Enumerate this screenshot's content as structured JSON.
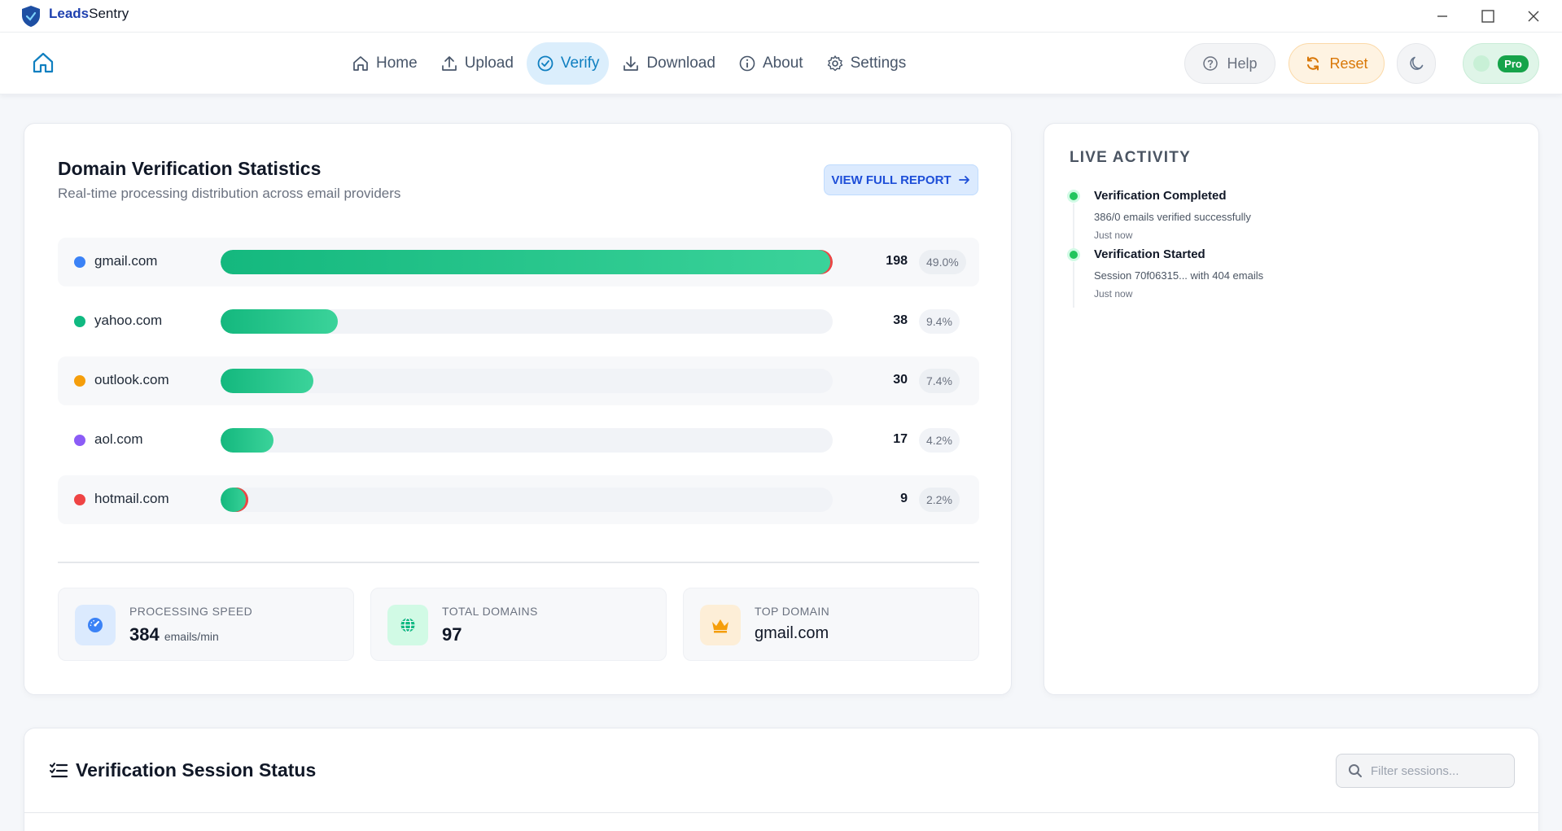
{
  "app": {
    "title_a": "Leads",
    "title_b": "Sentry"
  },
  "nav": [
    {
      "label": "Home",
      "icon": "home-icon"
    },
    {
      "label": "Upload",
      "icon": "upload-icon"
    },
    {
      "label": "Verify",
      "icon": "check-circle-icon",
      "active": true
    },
    {
      "label": "Download",
      "icon": "download-icon"
    },
    {
      "label": "About",
      "icon": "info-icon"
    },
    {
      "label": "Settings",
      "icon": "gear-icon"
    }
  ],
  "header_buttons": {
    "help": "Help",
    "reset": "Reset",
    "pro": "Pro"
  },
  "stats": {
    "title": "Domain Verification Statistics",
    "subtitle": "Real-time processing distribution across email providers",
    "report_button": "VIEW FULL REPORT",
    "domains": [
      {
        "name": "gmail.com",
        "count": "198",
        "percent": "49.0%",
        "fraction": 1.0,
        "color": "#3b82f6"
      },
      {
        "name": "yahoo.com",
        "count": "38",
        "percent": "9.4%",
        "fraction": 0.192,
        "color": "#10b981"
      },
      {
        "name": "outlook.com",
        "count": "30",
        "percent": "7.4%",
        "fraction": 0.152,
        "color": "#f59e0b"
      },
      {
        "name": "aol.com",
        "count": "17",
        "percent": "4.2%",
        "fraction": 0.086,
        "color": "#8b5cf6"
      },
      {
        "name": "hotmail.com",
        "count": "9",
        "percent": "2.2%",
        "fraction": 0.045,
        "color": "#ef4444"
      }
    ],
    "metrics": {
      "speed_label": "PROCESSING SPEED",
      "speed_value": "384",
      "speed_unit": "emails/min",
      "domains_label": "TOTAL DOMAINS",
      "domains_value": "97",
      "top_label": "TOP DOMAIN",
      "top_value": "gmail.com"
    }
  },
  "activity": {
    "title": "LIVE ACTIVITY",
    "items": [
      {
        "heading": "Verification Completed",
        "detail": "386/0 emails verified successfully",
        "time": "Just now"
      },
      {
        "heading": "Verification Started",
        "detail": "Session 70f06315... with 404 emails",
        "time": "Just now"
      }
    ]
  },
  "session": {
    "title": "Verification Session Status",
    "filter_placeholder": "Filter sessions..."
  },
  "colors": {
    "accent": "#0f7fc0",
    "bar": "#14b87e",
    "reset": "#d97706",
    "pro": "#16a34a"
  }
}
